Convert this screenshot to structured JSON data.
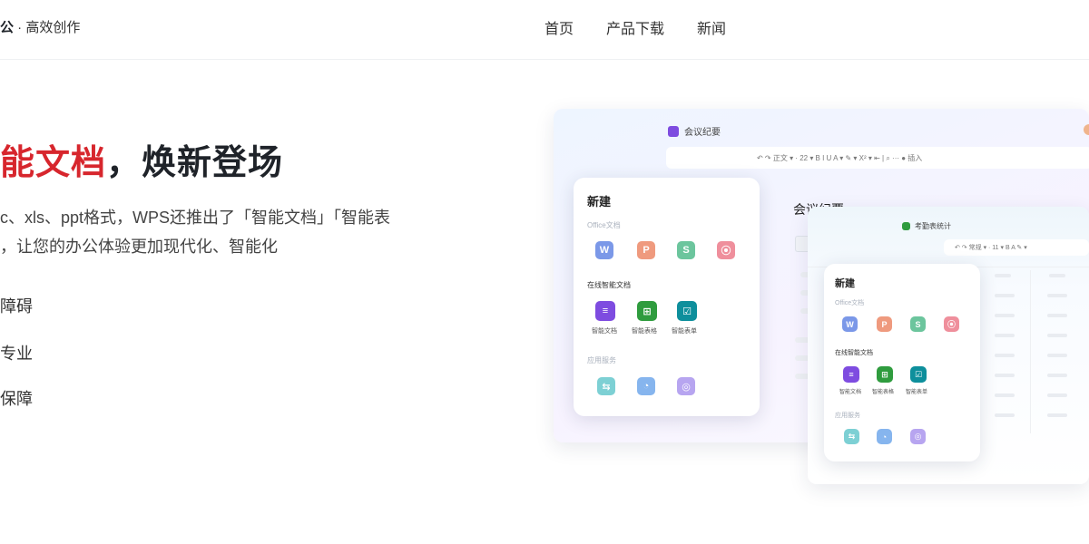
{
  "header": {
    "brand_bold": "公",
    "brand_rest": " · 高效创作",
    "nav": [
      "首页",
      "产品下载",
      "新闻"
    ]
  },
  "hero": {
    "headline_red": "能文档",
    "headline_rest": "，焕新登场",
    "desc_line1": "c、xls、ppt格式，WPS还推出了「智能文档」「智能表",
    "desc_line2": "，让您的办公体验更加现代化、智能化",
    "features": [
      "障碍",
      "专业",
      "保障"
    ]
  },
  "mockup": {
    "window1_title": "会议纪要",
    "window1_toolbar": "↶  ↷   正文 ▾   ·   22 ▾   B   I   U   A ▾   ✎ ▾   X² ▾   ⇤   |   ⌕   ···   ● 插入",
    "doc_heading": "会议纪要",
    "window2_title": "考勤表统计",
    "window2_toolbar": "↶  ↷   常规 ▾   ·   11 ▾   B   A   ✎ ▾",
    "panel_title": "新建",
    "section_office": "Office文档",
    "section_smart": "在线智能文档",
    "section_apps": "应用服务",
    "office_icons": [
      {
        "glyph": "W",
        "color": "#7b98e8"
      },
      {
        "glyph": "P",
        "color": "#ef9a7e"
      },
      {
        "glyph": "S",
        "color": "#6cc59d"
      },
      {
        "glyph": "⦿",
        "color": "#ef8f9c"
      }
    ],
    "smart_icons": [
      {
        "glyph": "≡",
        "color": "#7e4ce0",
        "label": "智能文档"
      },
      {
        "glyph": "⊞",
        "color": "#2f9c3e",
        "label": "智能表格"
      },
      {
        "glyph": "☑",
        "color": "#0e8f9c",
        "label": "智能表单"
      }
    ],
    "app_icons": [
      {
        "glyph": "⇆",
        "color": "#7dd0d4"
      },
      {
        "glyph": "◔",
        "color": "#86b5ee"
      },
      {
        "glyph": "◎",
        "color": "#b7a5f0"
      }
    ]
  }
}
